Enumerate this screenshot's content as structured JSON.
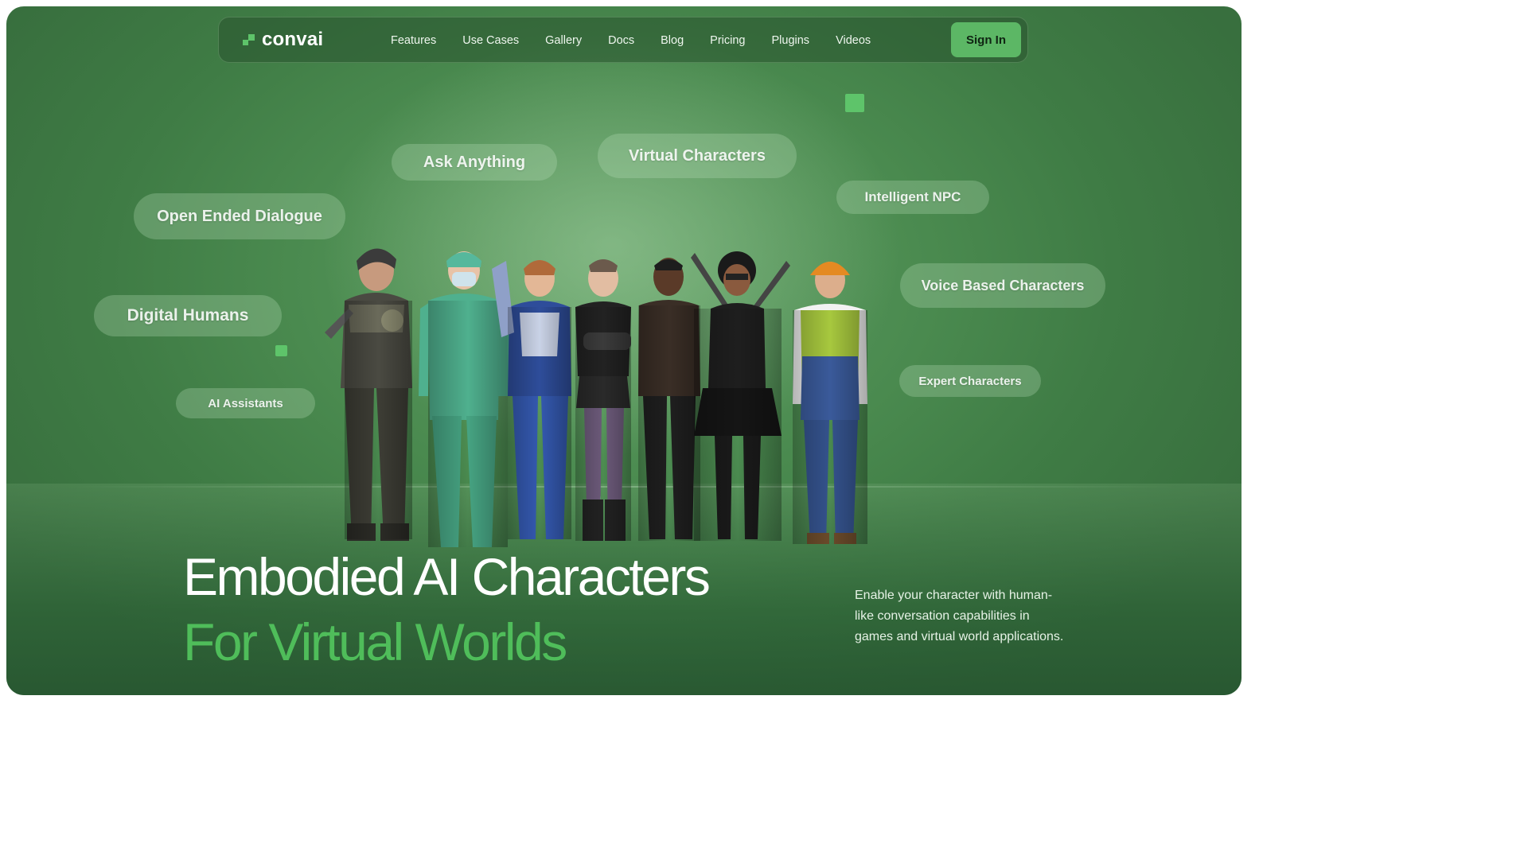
{
  "brand": {
    "name": "convai",
    "accent": "#5ec46a",
    "background": "#4a8a4f"
  },
  "nav": {
    "links": [
      "Features",
      "Use Cases",
      "Gallery",
      "Docs",
      "Blog",
      "Pricing",
      "Plugins",
      "Videos"
    ],
    "signin_label": "Sign In"
  },
  "tags": {
    "ask_anything": "Ask Anything",
    "virtual_characters": "Virtual Characters",
    "intelligent_npc": "Intelligent NPC",
    "open_ended_dialogue": "Open Ended Dialogue",
    "voice_based_characters": "Voice Based Characters",
    "digital_humans": "Digital Humans",
    "expert_characters": "Expert Characters",
    "ai_assistants": "AI Assistants"
  },
  "hero": {
    "title": "Embodied AI Characters",
    "subtitle": "For Virtual Worlds",
    "description": "Enable your character with human-like conversation capabilities in games and virtual world applications."
  },
  "characters": [
    {
      "name": "knight",
      "icon": "armored-warrior-figure"
    },
    {
      "name": "nurse",
      "icon": "surgeon-figure"
    },
    {
      "name": "space-suit",
      "icon": "armored-hero-figure"
    },
    {
      "name": "punk",
      "icon": "punk-girl-figure"
    },
    {
      "name": "man",
      "icon": "casual-man-figure"
    },
    {
      "name": "ninja",
      "icon": "ninja-girl-figure"
    },
    {
      "name": "worker",
      "icon": "construction-worker-figure"
    }
  ]
}
